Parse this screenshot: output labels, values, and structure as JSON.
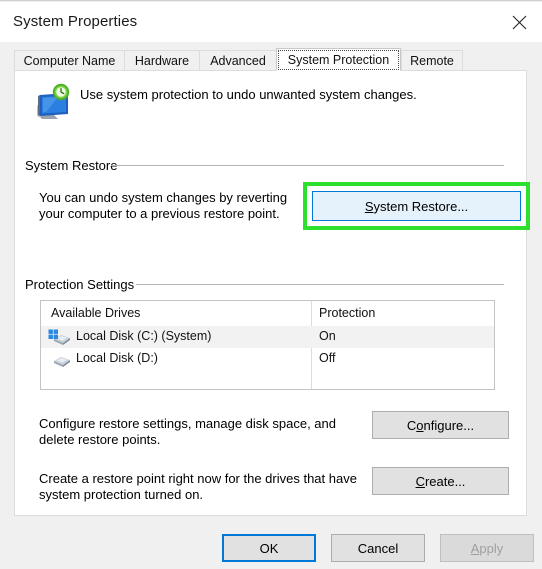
{
  "window": {
    "title": "System Properties",
    "close_icon": "close-icon"
  },
  "tabs": [
    {
      "label": "Computer Name",
      "selected": false
    },
    {
      "label": "Hardware",
      "selected": false
    },
    {
      "label": "Advanced",
      "selected": false
    },
    {
      "label": "System Protection",
      "selected": true
    },
    {
      "label": "Remote",
      "selected": false
    }
  ],
  "header": {
    "icon": "system-restore-icon",
    "description": "Use system protection to undo unwanted system changes."
  },
  "system_restore": {
    "group_title": "System Restore",
    "description": "You can undo system changes by reverting your computer to a previous restore point.",
    "button_label": "System Restore...",
    "button_accesskey": "S",
    "highlight_color": "#2ee02e",
    "button_state": "hover"
  },
  "protection_settings": {
    "group_title": "Protection Settings",
    "columns": [
      "Available Drives",
      "Protection"
    ],
    "rows": [
      {
        "drive": "Local Disk (C:) (System)",
        "protection": "On",
        "icon": "system-drive-icon",
        "selected": true
      },
      {
        "drive": "Local Disk (D:)",
        "protection": "Off",
        "icon": "drive-icon",
        "selected": false
      }
    ],
    "configure": {
      "description": "Configure restore settings, manage disk space, and delete restore points.",
      "button_label": "Configure...",
      "button_accesskey": "o"
    },
    "create": {
      "description": "Create a restore point right now for the drives that have system protection turned on.",
      "button_label": "Create...",
      "button_accesskey": "C"
    }
  },
  "footer": {
    "ok_label": "OK",
    "cancel_label": "Cancel",
    "apply_label": "Apply",
    "apply_accesskey": "A",
    "apply_enabled": false
  }
}
